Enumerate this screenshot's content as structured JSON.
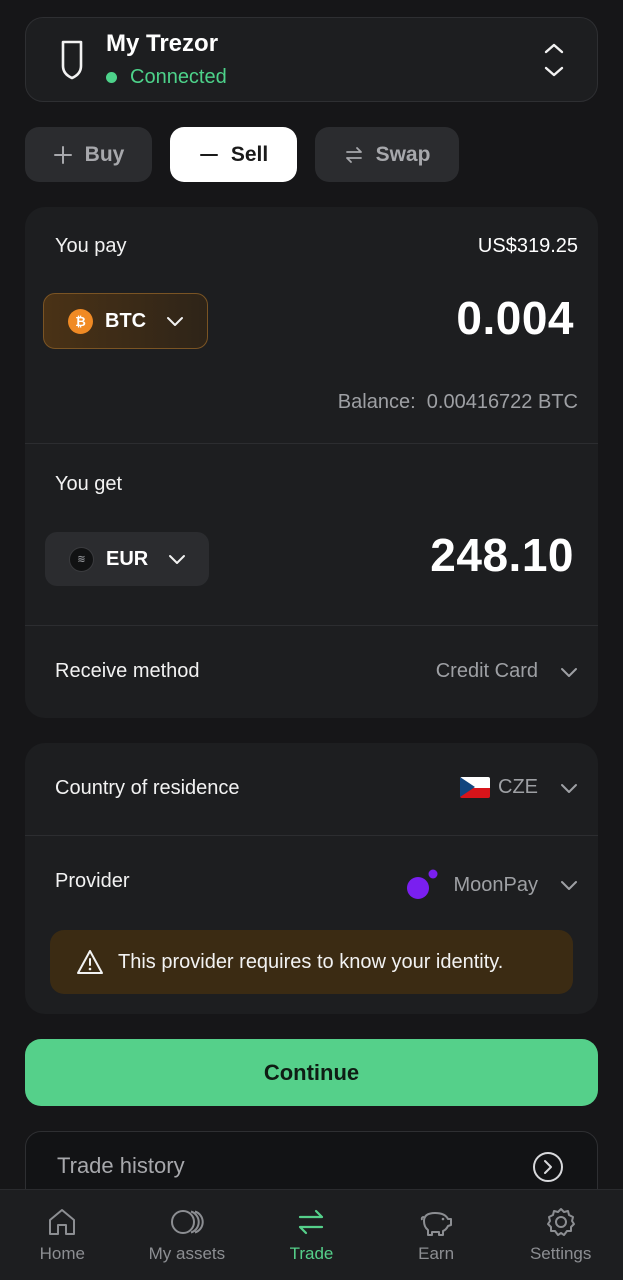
{
  "device": {
    "name": "My Trezor",
    "status": "Connected",
    "icons": {
      "device": "trezor-shield-icon",
      "switch": "chevron-up-down-icon"
    }
  },
  "tabs": [
    {
      "label": "Buy",
      "icon": "plus-icon",
      "active": false
    },
    {
      "label": "Sell",
      "icon": "minus-icon",
      "active": true
    },
    {
      "label": "Swap",
      "icon": "swap-arrows-icon",
      "active": false
    }
  ],
  "pay": {
    "label": "You pay",
    "fiat_value": "US$319.25",
    "coin": "BTC",
    "amount": "0.004",
    "balance_label": "Balance:",
    "balance_value": "0.00416722 BTC"
  },
  "get": {
    "label": "You get",
    "currency": "EUR",
    "amount": "248.10"
  },
  "receive_method": {
    "label": "Receive method",
    "value": "Credit Card"
  },
  "country": {
    "label": "Country of residence",
    "value": "CZE"
  },
  "provider": {
    "label": "Provider",
    "value": "MoonPay"
  },
  "warning": {
    "text": "This provider requires to know your identity.",
    "icon": "warning-triangle-icon"
  },
  "continue_label": "Continue",
  "trade_history": {
    "label": "Trade history",
    "icon": "arrow-right-circle-icon"
  },
  "nav": [
    {
      "label": "Home",
      "icon": "home-icon",
      "active": false
    },
    {
      "label": "My assets",
      "icon": "assets-icon",
      "active": false
    },
    {
      "label": "Trade",
      "icon": "trade-arrows-icon",
      "active": true
    },
    {
      "label": "Earn",
      "icon": "piggy-bank-icon",
      "active": false
    },
    {
      "label": "Settings",
      "icon": "gear-icon",
      "active": false
    }
  ],
  "colors": {
    "background": "#161618",
    "panel": "#1d1e20",
    "accent_green": "#55d08a",
    "status_green": "#4dd28a",
    "warning_bg": "#3b2b13",
    "btc_orange": "#f08a24",
    "moonpay_purple": "#7a1ff0"
  }
}
